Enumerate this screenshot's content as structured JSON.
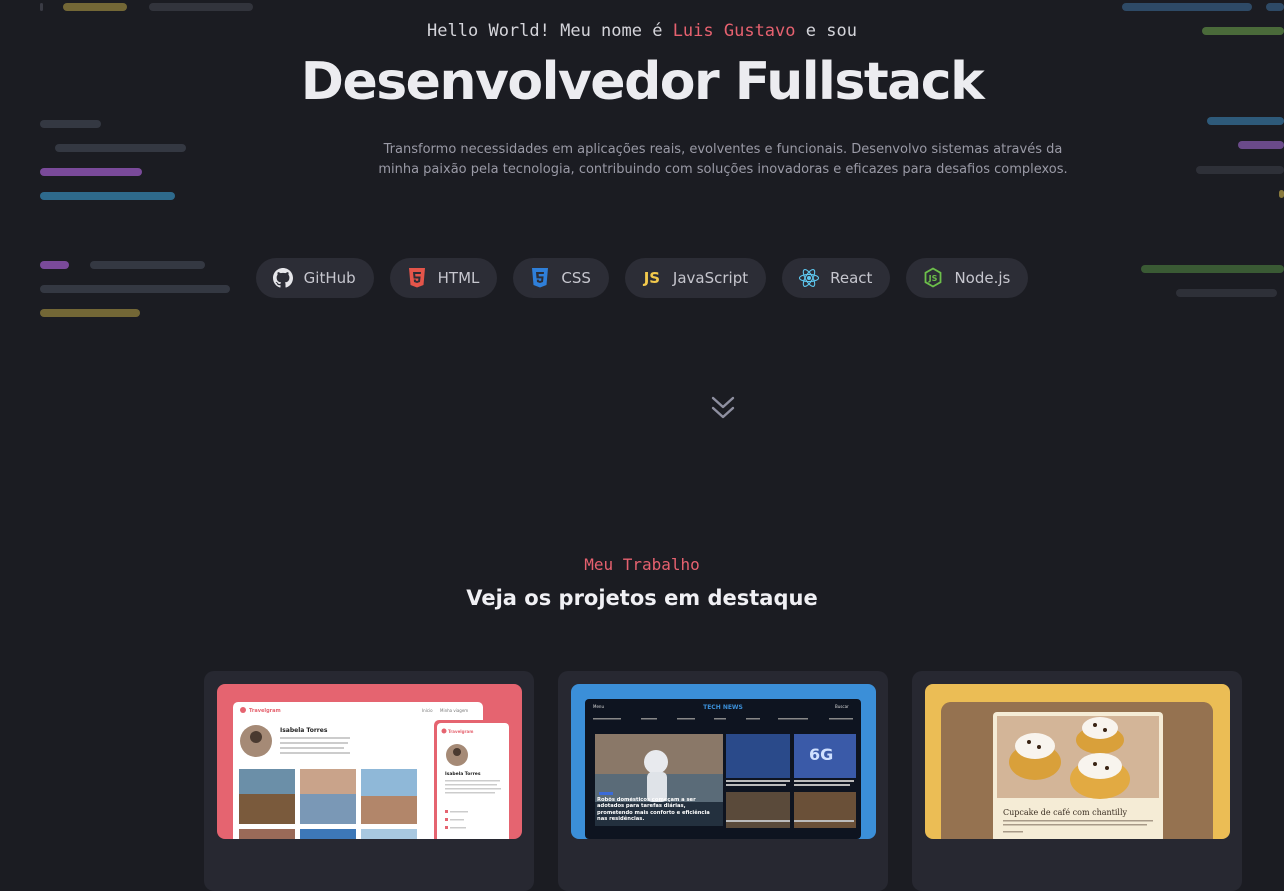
{
  "hero": {
    "greeting_prefix": "Hello World! Meu nome é ",
    "greeting_name": "Luis Gustavo",
    "greeting_suffix": " e sou",
    "title": "Desenvolvedor Fullstack",
    "description": "Transformo necessidades em aplicações reais, evolventes e funcionais. Desenvolvo sistemas através da minha paixão pela tecnologia, contribuindo com soluções inovadoras e eficazes para desafios complexos."
  },
  "skills": [
    {
      "label": "GitHub",
      "icon": "github-icon",
      "color": "#e6e6ea"
    },
    {
      "label": "HTML",
      "icon": "html5-icon",
      "color": "#e4554a"
    },
    {
      "label": "CSS",
      "icon": "css3-icon",
      "color": "#2f7fd9"
    },
    {
      "label": "JavaScript",
      "icon": "js-icon",
      "color": "#f2c94c"
    },
    {
      "label": "React",
      "icon": "react-icon",
      "color": "#5ec8f0"
    },
    {
      "label": "Node.js",
      "icon": "nodejs-icon",
      "color": "#6cbf4a"
    }
  ],
  "scroll_icon": "double-chevron-down-icon",
  "work": {
    "kicker": "Meu Trabalho",
    "title": "Veja os projetos em destaque"
  },
  "projects": [
    {
      "accent": "#e56470",
      "logo": "Travelgram",
      "nav_a": "Início",
      "nav_b": "Minha viagem",
      "profile_name": "Isabela Torres",
      "mobile_logo": "Travelgram",
      "mobile_name": "Isabela Torres"
    },
    {
      "accent": "#3b8fd8",
      "menu": "Menu",
      "brand": "TECH NEWS",
      "search": "Buscar",
      "headline": "Robôs domésticos começam a ser adotados para tarefas diárias, prometendo mais conforto e eficiência nas residências."
    },
    {
      "accent": "#ebbd55",
      "recipe_title": "Cupcake de café com chantilly"
    }
  ],
  "colors": {
    "background": "#1b1c22",
    "accent_red": "#e6616f",
    "chip_bg": "#2c2d36"
  }
}
